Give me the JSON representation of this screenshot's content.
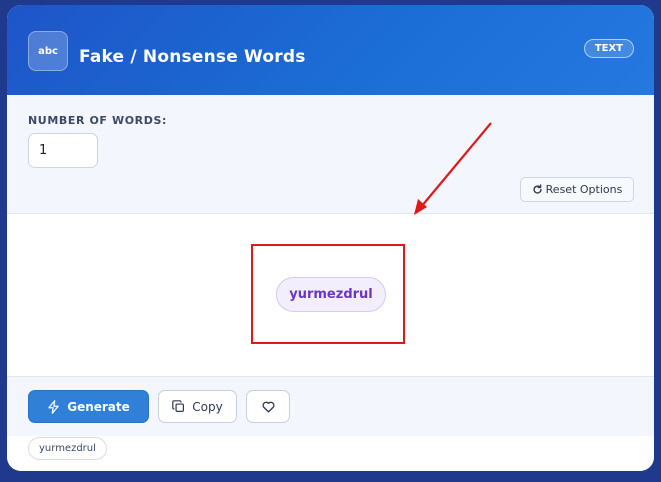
{
  "header": {
    "logo_text": "abc",
    "title": "Fake / Nonsense Words",
    "tag": "TEXT"
  },
  "options": {
    "number_label": "NUMBER OF WORDS:",
    "number_value": "1",
    "reset_label": "Reset Options",
    "reset_icon": "refresh-icon"
  },
  "result": {
    "word": "yurmezdrul"
  },
  "actions": {
    "generate_label": "Generate",
    "generate_icon": "lightning-icon",
    "copy_label": "Copy",
    "copy_icon": "copy-icon",
    "favorite_icon": "heart-icon"
  },
  "history": {
    "items": [
      "yurmezdrul"
    ]
  },
  "colors": {
    "header_blue": "#1e55c8",
    "accent_purple": "#6a36c4",
    "generate_blue": "#3080d8",
    "annotation_red": "#e01818"
  }
}
